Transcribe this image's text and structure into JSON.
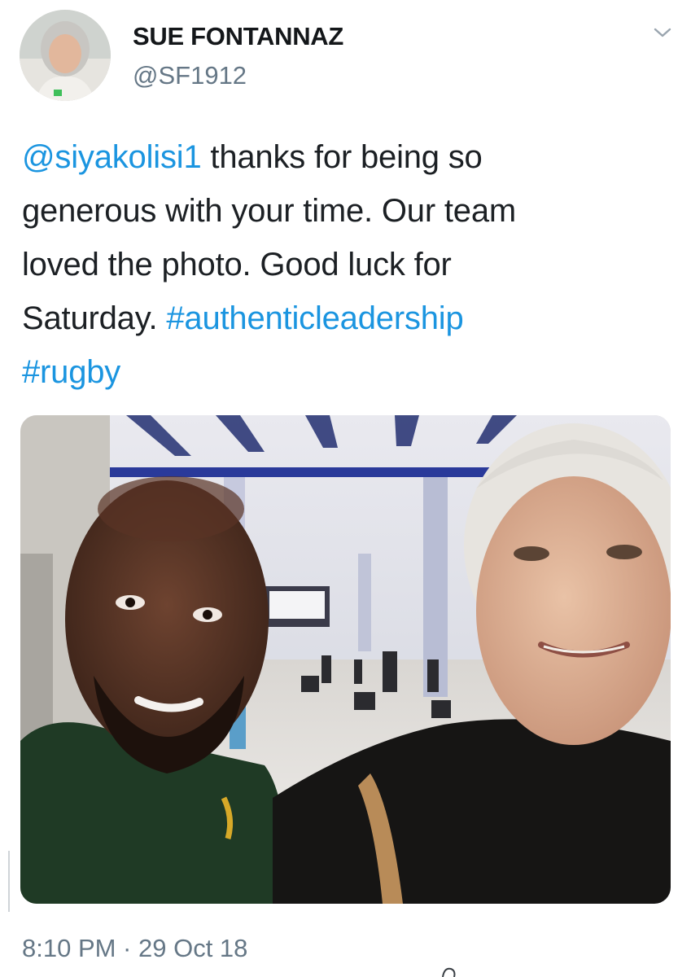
{
  "tweet": {
    "author": {
      "display_name": "SUE FONTANNAZ",
      "handle": "@SF1912"
    },
    "text_lines": [
      [
        {
          "text": "@siyakolisi1",
          "link": true
        },
        {
          "text": " thanks for being so",
          "link": false
        }
      ],
      [
        {
          "text": "generous with your time. Our team",
          "link": false
        }
      ],
      [
        {
          "text": "loved the photo. Good luck for",
          "link": false
        }
      ],
      [
        {
          "text": "Saturday. ",
          "link": false
        },
        {
          "text": "#authenticleadership",
          "link": true
        }
      ],
      [
        {
          "text": "#rugby",
          "link": true
        }
      ]
    ],
    "timestamp": "8:10 PM · 29 Oct 18"
  },
  "icons": {
    "menu": "chevron-down-icon"
  },
  "colors": {
    "link": "#1b95e0",
    "secondary_text": "#657786",
    "primary_text": "#14171a"
  }
}
